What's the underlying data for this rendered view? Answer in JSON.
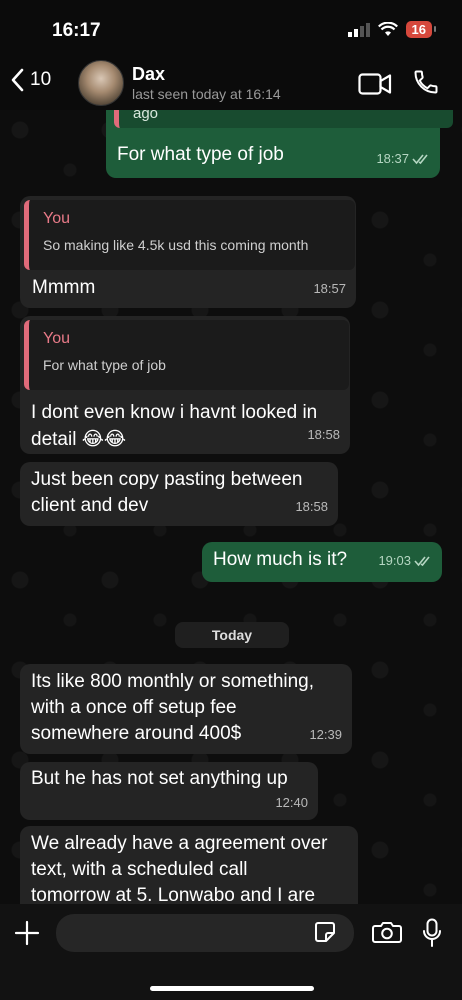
{
  "status_bar": {
    "time": "16:17",
    "battery": "16"
  },
  "header": {
    "back_count": "10",
    "contact_name": "Dax",
    "last_seen": "last seen today at 16:14"
  },
  "messages": [
    {
      "dir": "out",
      "quoted_tail": "ago",
      "text": "For what type of job",
      "time": "18:37",
      "read": true
    },
    {
      "dir": "in",
      "quote_name": "You",
      "quote_text": "So making like 4.5k usd this coming month",
      "text": "Mmmm",
      "time": "18:57"
    },
    {
      "dir": "in",
      "quote_name": "You",
      "quote_text": "For what type of job",
      "text_line1": "I dont even know i havnt looked in",
      "text_line2": "detail 😂😂",
      "time": "18:58"
    },
    {
      "dir": "in",
      "text_line1": "Just been copy pasting between",
      "text_line2": "client and dev",
      "time": "18:58"
    },
    {
      "dir": "out",
      "text": "How much is it?",
      "time": "19:03",
      "read": true
    },
    {
      "dir": "in",
      "text_line1": "Its like 800 monthly or something,",
      "text_line2": "with a once off setup fee",
      "text_line3": "somewhere around 400$",
      "time": "12:39"
    },
    {
      "dir": "in",
      "text": "But he has not set anything up",
      "time": "12:40"
    },
    {
      "dir": "in",
      "text_line1": "We already have a agreement over",
      "text_line2": "text, with a scheduled call",
      "text_line3": "tomorrow at 5. Lonwabo and I are"
    }
  ],
  "date_separator": "Today",
  "input": {
    "placeholder": ""
  },
  "colors": {
    "incoming": "#242424",
    "outgoing": "#1e5d3a",
    "quote_accent": "#e06b7a"
  }
}
